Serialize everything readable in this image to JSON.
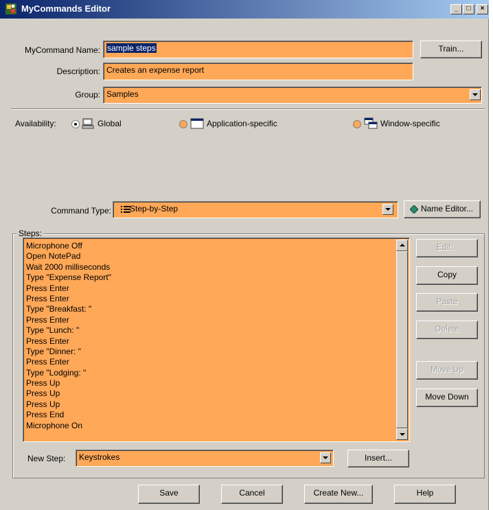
{
  "window": {
    "title": "MyCommands Editor",
    "minimize_label": "_",
    "maximize_label": "□",
    "close_label": "×"
  },
  "form": {
    "name_label": "MyCommand Name:",
    "name_value": "sample steps",
    "train_label": "Train...",
    "description_label": "Description:",
    "description_value": "Creates an expense report",
    "group_label": "Group:",
    "group_value": "Samples"
  },
  "availability": {
    "label": "Availability:",
    "options": [
      {
        "label": "Global",
        "selected": true
      },
      {
        "label": "Application-specific",
        "selected": false
      },
      {
        "label": "Window-specific",
        "selected": false
      }
    ]
  },
  "command_type": {
    "label": "Command Type:",
    "value": "Step-by-Step",
    "name_editor_label": "Name Editor..."
  },
  "steps": {
    "group_label": "Steps:",
    "items": [
      "Microphone Off",
      "Open NotePad",
      "Wait 2000 milliseconds",
      "Type \"Expense Report\"",
      "Press Enter",
      "Press Enter",
      "Type \"Breakfast: \"",
      "Press Enter",
      "Type \"Lunch: \"",
      "Press Enter",
      "Type \"Dinner: \"",
      "Press Enter",
      "Type \"Lodging: \"",
      "Press Up",
      "Press Up",
      "Press Up",
      "Press End",
      "Microphone On"
    ],
    "buttons": {
      "edit": "Edit...",
      "copy": "Copy",
      "paste": "Paste",
      "delete": "Delete",
      "move_up": "Move Up",
      "move_down": "Move Down"
    },
    "new_step_label": "New Step:",
    "new_step_value": "Keystrokes",
    "insert_label": "Insert..."
  },
  "footer": {
    "save": "Save",
    "cancel": "Cancel",
    "create_new": "Create New...",
    "help": "Help"
  },
  "colors": {
    "field_bg": "#ffa858",
    "dialog_bg": "#d4d0c8",
    "title_start": "#0a246a",
    "title_end": "#a6caf0"
  }
}
